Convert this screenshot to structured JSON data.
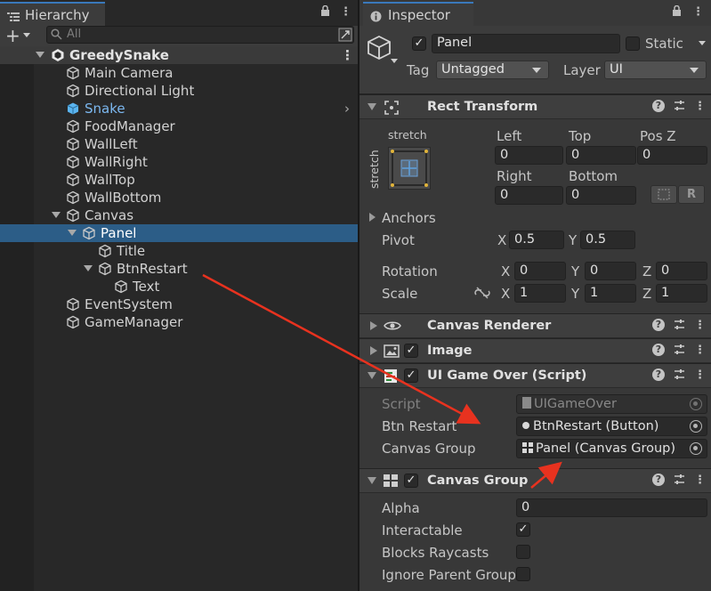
{
  "hierarchy": {
    "tab_title": "Hierarchy",
    "add_button": "+",
    "search_placeholder": "All",
    "items": [
      {
        "label": "GreedySnake",
        "depth": 0,
        "scene": true
      },
      {
        "label": "Main Camera",
        "depth": 1
      },
      {
        "label": "Directional Light",
        "depth": 1
      },
      {
        "label": "Snake",
        "depth": 1,
        "prefab": true
      },
      {
        "label": "FoodManager",
        "depth": 1
      },
      {
        "label": "WallLeft",
        "depth": 1
      },
      {
        "label": "WallRight",
        "depth": 1
      },
      {
        "label": "WallTop",
        "depth": 1
      },
      {
        "label": "WallBottom",
        "depth": 1
      },
      {
        "label": "Canvas",
        "depth": 1,
        "open": true
      },
      {
        "label": "Panel",
        "depth": 2,
        "open": true,
        "selected": true
      },
      {
        "label": "Title",
        "depth": 3
      },
      {
        "label": "BtnRestart",
        "depth": 3,
        "open": true
      },
      {
        "label": "Text",
        "depth": 4
      },
      {
        "label": "EventSystem",
        "depth": 1
      },
      {
        "label": "GameManager",
        "depth": 1
      }
    ]
  },
  "inspector": {
    "tab_title": "Inspector",
    "object_name": "Panel",
    "static_label": "Static",
    "tag_label": "Tag",
    "tag_value": "Untagged",
    "layer_label": "Layer",
    "layer_value": "UI",
    "rect_transform": {
      "title": "Rect Transform",
      "anchor_preset_h": "stretch",
      "anchor_preset_v": "stretch",
      "left_label": "Left",
      "left": "0",
      "top_label": "Top",
      "top": "0",
      "posz_label": "Pos Z",
      "posz": "0",
      "right_label": "Right",
      "right": "0",
      "bottom_label": "Bottom",
      "bottom": "0",
      "raw_button": "R",
      "anchors_label": "Anchors",
      "pivot_label": "Pivot",
      "pivot_x": "0.5",
      "pivot_y": "0.5",
      "rotation_label": "Rotation",
      "rot_x": "0",
      "rot_y": "0",
      "rot_z": "0",
      "scale_label": "Scale",
      "scale_x": "1",
      "scale_y": "1",
      "scale_z": "1",
      "x": "X",
      "y": "Y",
      "z": "Z"
    },
    "canvas_renderer": {
      "title": "Canvas Renderer"
    },
    "image": {
      "title": "Image"
    },
    "ui_game_over": {
      "title": "UI Game Over (Script)",
      "script_label": "Script",
      "script_value": "UIGameOver",
      "btn_restart_label": "Btn Restart",
      "btn_restart_value": "BtnRestart (Button)",
      "canvas_group_label": "Canvas Group",
      "canvas_group_value": "Panel (Canvas Group)"
    },
    "canvas_group": {
      "title": "Canvas Group",
      "alpha_label": "Alpha",
      "alpha": "0",
      "interactable_label": "Interactable",
      "blocks_raycasts_label": "Blocks Raycasts",
      "ignore_parent_label": "Ignore Parent Groups"
    },
    "help_glyph": "?",
    "check_glyph": "✓"
  },
  "colors": {
    "selection": "#2c5d87",
    "accent": "#3a79bb",
    "prefab_text": "#7cb8f0",
    "arrow": "#e8321f"
  }
}
